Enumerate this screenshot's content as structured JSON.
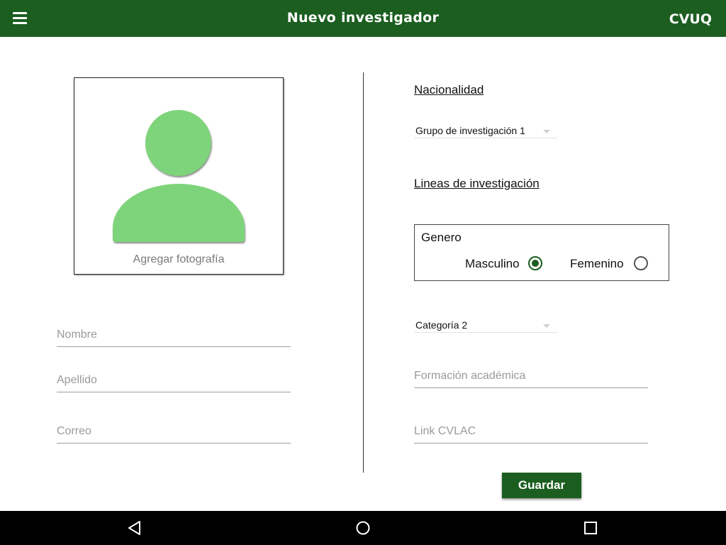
{
  "header": {
    "title": "Nuevo investigador",
    "brand": "CVUQ",
    "menu_icon": "hamburger-icon"
  },
  "photo": {
    "label": "Agregar fotografía",
    "avatar_color": "#7ed47a",
    "icon": "person-avatar-icon"
  },
  "form_left": {
    "nombre_placeholder": "Nombre",
    "apellido_placeholder": "Apellido",
    "correo_placeholder": "Correo"
  },
  "form_right": {
    "nacionalidad_label": "Nacionalidad",
    "grupo_value": "Grupo de investigación 1",
    "lineas_label": "Lineas de investigación",
    "genero": {
      "title": "Genero",
      "options": [
        "Masculino",
        "Femenino"
      ],
      "selected": "Masculino"
    },
    "categoria_value": "Categoría 2",
    "formacion_placeholder": "Formación académica",
    "cvlac_placeholder": "Link CVLAC"
  },
  "actions": {
    "save_label": "Guardar"
  },
  "nav": {
    "back_icon": "back-triangle-icon",
    "home_icon": "home-circle-icon",
    "recents_icon": "recents-square-icon"
  },
  "colors": {
    "primary": "#1b5e20",
    "accent": "#7ed47a",
    "navbar": "#000000"
  }
}
